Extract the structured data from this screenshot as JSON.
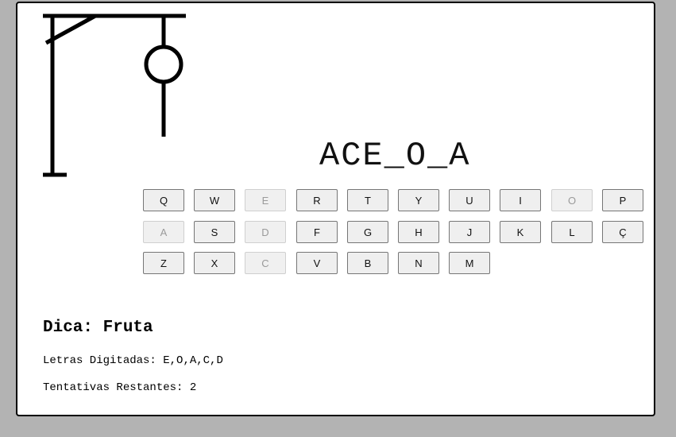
{
  "game": {
    "word_display": "ACE_O_A",
    "hint_label": "Dica:",
    "hint_value": "Fruta",
    "typed_label": "Letras Digitadas:",
    "typed_value": "E,O,A,C,D",
    "remaining_label": "Tentativas Restantes:",
    "remaining_value": "2"
  },
  "keyboard": {
    "rows": [
      [
        "Q",
        "W",
        "E",
        "R",
        "T",
        "Y",
        "U",
        "I",
        "O",
        "P"
      ],
      [
        "A",
        "S",
        "D",
        "F",
        "G",
        "H",
        "J",
        "K",
        "L",
        "Ç"
      ],
      [
        "Z",
        "X",
        "C",
        "V",
        "B",
        "N",
        "M"
      ]
    ],
    "disabled": [
      "E",
      "O",
      "A",
      "D",
      "C"
    ]
  },
  "colors": {
    "background": "#b3b3b3",
    "panel": "#ffffff",
    "key_bg": "#efefef",
    "key_disabled_text": "#9a9a9a"
  }
}
